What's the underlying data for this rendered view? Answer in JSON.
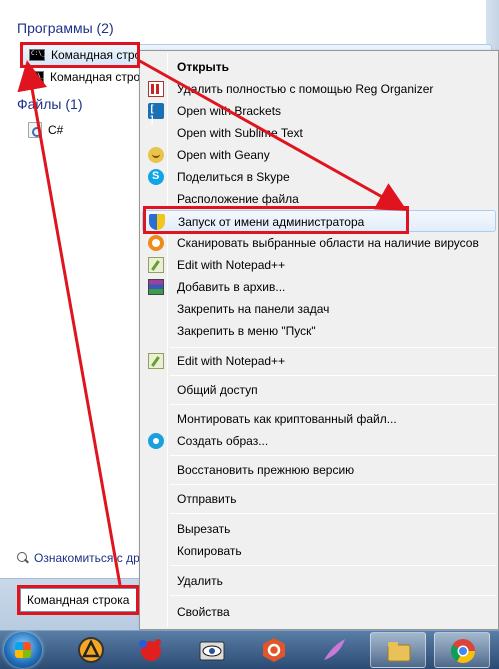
{
  "start_menu": {
    "programs_header": "Программы (2)",
    "programs": [
      {
        "label": "Командная стро"
      },
      {
        "label": "Командная стро"
      }
    ],
    "files_header": "Файлы (1)",
    "files": [
      {
        "label": "C#"
      }
    ],
    "see_more": "Ознакомиться с дру",
    "search_value": "Командная строка"
  },
  "context_menu": {
    "items": [
      {
        "label": "Открыть",
        "icon": "none",
        "bold": true
      },
      {
        "label": "Удалить полностью с помощью Reg Organizer",
        "icon": "reg-organizer-icon"
      },
      {
        "label": "Open with Brackets",
        "icon": "brackets-icon"
      },
      {
        "label": "Open with Sublime Text",
        "icon": "none"
      },
      {
        "label": "Open with Geany",
        "icon": "geany-icon"
      },
      {
        "label": "Поделиться в Skype",
        "icon": "skype-icon"
      },
      {
        "label": "Расположение файла",
        "icon": "none"
      },
      {
        "label": "Запуск от имени администратора",
        "icon": "uac-shield-icon",
        "highlighted": true
      },
      {
        "label": "Сканировать выбранные области на наличие вирусов",
        "icon": "avast-icon"
      },
      {
        "label": "Edit with Notepad++",
        "icon": "notepad-plus-plus-icon"
      },
      {
        "label": "Добавить в архив...",
        "icon": "winrar-icon"
      },
      {
        "label": "Закрепить на панели задач",
        "icon": "none"
      },
      {
        "label": "Закрепить в меню \"Пуск\"",
        "icon": "none"
      },
      {
        "label": "Edit with Notepad++",
        "icon": "notepad-plus-plus-icon"
      },
      {
        "label": "Общий доступ",
        "icon": "none"
      },
      {
        "label": "Монтировать как криптованный файл...",
        "icon": "none"
      },
      {
        "label": "Создать образ...",
        "icon": "burn-disc-icon"
      },
      {
        "label": "Восстановить прежнюю версию",
        "icon": "none"
      },
      {
        "label": "Отправить",
        "icon": "none"
      },
      {
        "label": "Вырезать",
        "icon": "none"
      },
      {
        "label": "Копировать",
        "icon": "none"
      },
      {
        "label": "Удалить",
        "icon": "none"
      },
      {
        "label": "Свойства",
        "icon": "none"
      }
    ]
  },
  "taskbar": {
    "buttons": [
      {
        "icon": "archicad-icon"
      },
      {
        "icon": "paint-splash-icon"
      },
      {
        "icon": "eye-camera-icon"
      },
      {
        "icon": "sourcetree-icon"
      },
      {
        "icon": "feather-icon"
      },
      {
        "icon": "folder-icon"
      },
      {
        "icon": "chrome-icon"
      }
    ]
  },
  "colors": {
    "annotation_red": "#e0141e",
    "header_blue": "#1e3287",
    "menu_bg": "#f0f0f0"
  }
}
